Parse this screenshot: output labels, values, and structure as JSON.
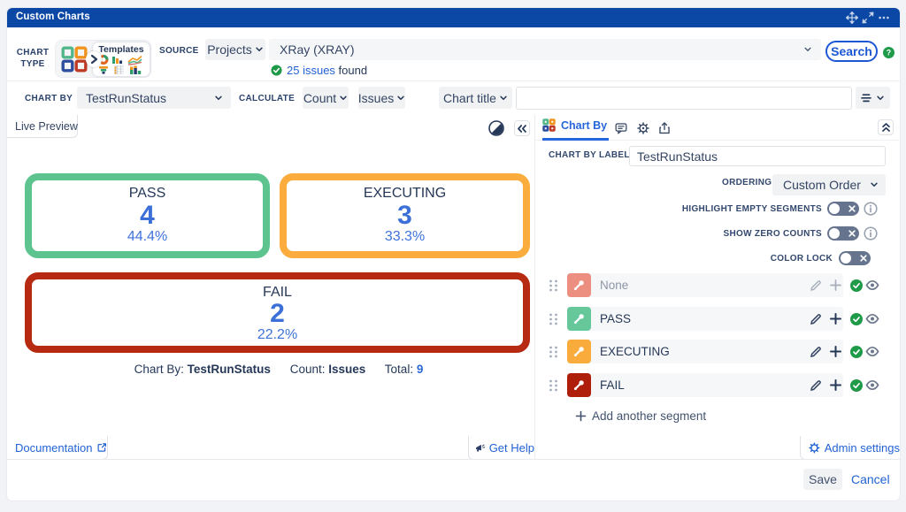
{
  "window": {
    "title": "Custom Charts",
    "header_icons": [
      "move",
      "resize",
      "more-options"
    ]
  },
  "toolbar": {
    "chart_type_label_line1": "CHART",
    "chart_type_label_line2": "TYPE",
    "templates_label": "Templates",
    "source_label": "SOURCE",
    "projects_button": "Projects",
    "source_value": "XRay (XRAY)",
    "issues_found_link": "25 issues",
    "issues_found_suffix": " found",
    "search_button": "Search",
    "chart_by_label": "CHART BY",
    "chart_by_value": "TestRunStatus",
    "calculate_label": "CALCULATE",
    "count_button": "Count",
    "issues_button": "Issues",
    "chart_title_button": "Chart title",
    "chart_title_value": "",
    "chart_title_placeholder": ""
  },
  "preview": {
    "tab_label": "Live Preview",
    "documentation_link": "Documentation",
    "get_help_link": "Get Help"
  },
  "chart_data": {
    "type": "segment_counter_cards",
    "categories": [
      "PASS",
      "EXECUTING",
      "FAIL"
    ],
    "values": [
      4,
      3,
      2
    ],
    "percentages": [
      "44.4%",
      "33.3%",
      "22.2%"
    ],
    "colors": [
      "#5EC48F",
      "#FAAD3C",
      "#B52A10"
    ],
    "total": 9,
    "summary": {
      "chart_by_label": "Chart By:",
      "chart_by_value": "TestRunStatus",
      "count_label": "Count:",
      "count_value": "Issues",
      "total_label": "Total:",
      "total_value": "9"
    }
  },
  "settings": {
    "active_tab": "Chart By",
    "tab_icons": [
      "comment",
      "gear",
      "share"
    ],
    "chart_by_label_field": {
      "label": "CHART BY LABEL",
      "value": "TestRunStatus"
    },
    "ordering": {
      "label": "ORDERING",
      "value": "Custom Order"
    },
    "toggles": [
      {
        "label": "HIGHLIGHT EMPTY SEGMENTS",
        "state": "off",
        "info": true
      },
      {
        "label": "SHOW ZERO COUNTS",
        "state": "off",
        "info": true
      },
      {
        "label": "COLOR LOCK",
        "state": "off",
        "info": false
      }
    ],
    "segments": [
      {
        "label": "None",
        "color": "#EC8E80",
        "muted": true
      },
      {
        "label": "PASS",
        "color": "#66C79B",
        "muted": false
      },
      {
        "label": "EXECUTING",
        "color": "#F9AB3C",
        "muted": false
      },
      {
        "label": "FAIL",
        "color": "#AE1E0A",
        "muted": false
      }
    ],
    "add_segment_label": "Add another segment",
    "admin_settings_link": "Admin settings"
  },
  "footer": {
    "save_button": "Save",
    "cancel_button": "Cancel"
  }
}
